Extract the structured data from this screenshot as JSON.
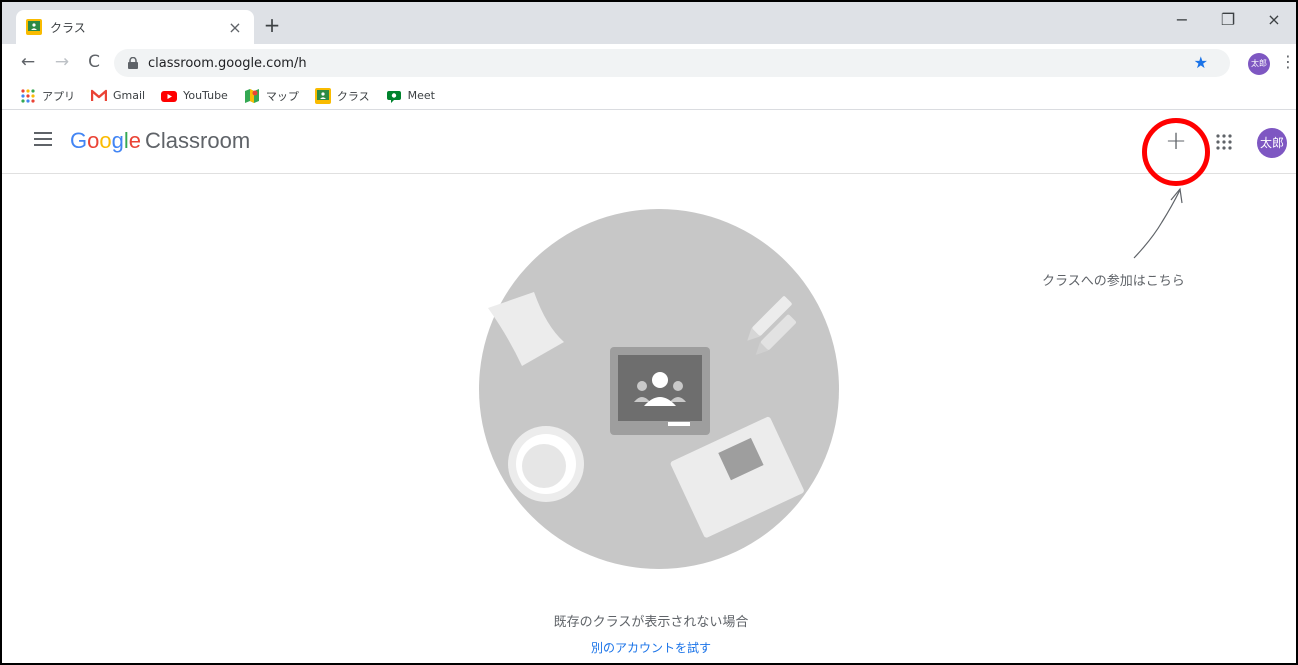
{
  "browser": {
    "tab_title": "クラス",
    "tab_close": "×",
    "new_tab": "+",
    "minimize": "−",
    "restore": "❐",
    "close": "×",
    "url": "classroom.google.com/h",
    "profile_initials": "太郎"
  },
  "bookmarks": [
    {
      "label": "アプリ",
      "icon": "apps-icon"
    },
    {
      "label": "Gmail",
      "icon": "gmail-icon"
    },
    {
      "label": "YouTube",
      "icon": "youtube-icon"
    },
    {
      "label": "マップ",
      "icon": "maps-icon"
    },
    {
      "label": "クラス",
      "icon": "classroom-icon"
    },
    {
      "label": "Meet",
      "icon": "meet-icon"
    }
  ],
  "header": {
    "brand_google": "Google",
    "brand_product": "Classroom",
    "add_button": "+",
    "avatar_initials": "太郎"
  },
  "annotation": {
    "text": "クラスへの参加はこちら"
  },
  "main": {
    "empty_message": "既存のクラスが表示されない場合",
    "switch_account": "別のアカウントを試す"
  },
  "colors": {
    "accent": "#1a73e8",
    "avatar": "#7e57c2",
    "highlight": "#ff0000"
  }
}
